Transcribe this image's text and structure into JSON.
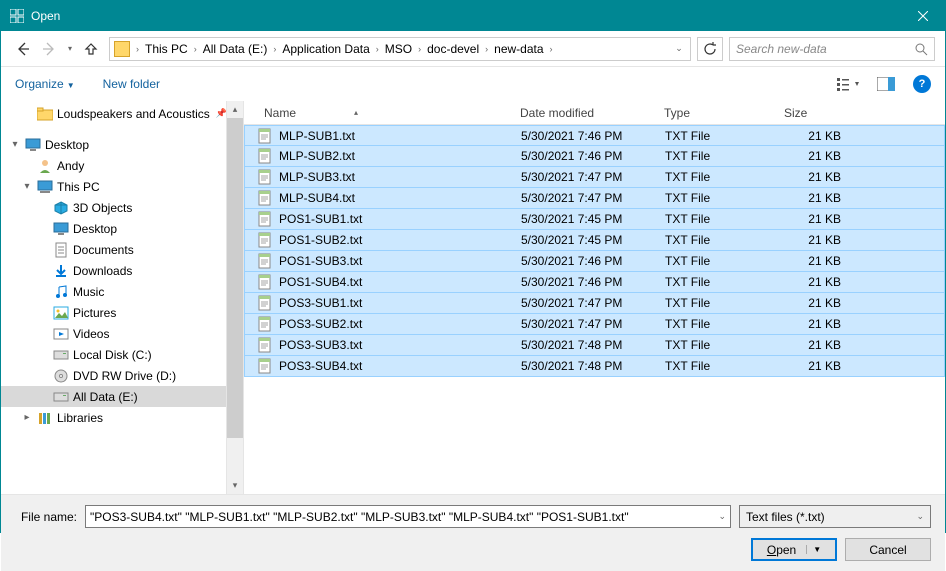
{
  "title": "Open",
  "breadcrumb": [
    "This PC",
    "All Data (E:)",
    "Application Data",
    "MSO",
    "doc-devel",
    "new-data"
  ],
  "search_placeholder": "Search new-data",
  "toolbar": {
    "organize": "Organize",
    "newfolder": "New folder"
  },
  "tree": [
    {
      "label": "Loudspeakers and Acoustics",
      "indent": 1,
      "icon": "folder",
      "pin": true
    },
    {
      "label": "",
      "spacer": true
    },
    {
      "label": "Desktop",
      "indent": 0,
      "icon": "desktop",
      "exp": "▾"
    },
    {
      "label": "Andy",
      "indent": 1,
      "icon": "user"
    },
    {
      "label": "This PC",
      "indent": 1,
      "icon": "pc",
      "exp": "▾"
    },
    {
      "label": "3D Objects",
      "indent": 2,
      "icon": "3d"
    },
    {
      "label": "Desktop",
      "indent": 2,
      "icon": "desktop2"
    },
    {
      "label": "Documents",
      "indent": 2,
      "icon": "doc"
    },
    {
      "label": "Downloads",
      "indent": 2,
      "icon": "down"
    },
    {
      "label": "Music",
      "indent": 2,
      "icon": "music"
    },
    {
      "label": "Pictures",
      "indent": 2,
      "icon": "pic"
    },
    {
      "label": "Videos",
      "indent": 2,
      "icon": "vid"
    },
    {
      "label": "Local Disk (C:)",
      "indent": 2,
      "icon": "disk"
    },
    {
      "label": "DVD RW Drive (D:)",
      "indent": 2,
      "icon": "dvd"
    },
    {
      "label": "All Data (E:)",
      "indent": 2,
      "icon": "disk",
      "sel": true
    },
    {
      "label": "Libraries",
      "indent": 1,
      "icon": "lib",
      "exp": "▸"
    }
  ],
  "columns": {
    "name": "Name",
    "date": "Date modified",
    "type": "Type",
    "size": "Size"
  },
  "files": [
    {
      "name": "MLP-SUB1.txt",
      "date": "5/30/2021 7:46 PM",
      "type": "TXT File",
      "size": "21 KB"
    },
    {
      "name": "MLP-SUB2.txt",
      "date": "5/30/2021 7:46 PM",
      "type": "TXT File",
      "size": "21 KB"
    },
    {
      "name": "MLP-SUB3.txt",
      "date": "5/30/2021 7:47 PM",
      "type": "TXT File",
      "size": "21 KB"
    },
    {
      "name": "MLP-SUB4.txt",
      "date": "5/30/2021 7:47 PM",
      "type": "TXT File",
      "size": "21 KB"
    },
    {
      "name": "POS1-SUB1.txt",
      "date": "5/30/2021 7:45 PM",
      "type": "TXT File",
      "size": "21 KB"
    },
    {
      "name": "POS1-SUB2.txt",
      "date": "5/30/2021 7:45 PM",
      "type": "TXT File",
      "size": "21 KB"
    },
    {
      "name": "POS1-SUB3.txt",
      "date": "5/30/2021 7:46 PM",
      "type": "TXT File",
      "size": "21 KB"
    },
    {
      "name": "POS1-SUB4.txt",
      "date": "5/30/2021 7:46 PM",
      "type": "TXT File",
      "size": "21 KB"
    },
    {
      "name": "POS3-SUB1.txt",
      "date": "5/30/2021 7:47 PM",
      "type": "TXT File",
      "size": "21 KB"
    },
    {
      "name": "POS3-SUB2.txt",
      "date": "5/30/2021 7:47 PM",
      "type": "TXT File",
      "size": "21 KB"
    },
    {
      "name": "POS3-SUB3.txt",
      "date": "5/30/2021 7:48 PM",
      "type": "TXT File",
      "size": "21 KB"
    },
    {
      "name": "POS3-SUB4.txt",
      "date": "5/30/2021 7:48 PM",
      "type": "TXT File",
      "size": "21 KB"
    }
  ],
  "filename_label": "File name:",
  "filename_value": "\"POS3-SUB4.txt\" \"MLP-SUB1.txt\" \"MLP-SUB2.txt\" \"MLP-SUB3.txt\" \"MLP-SUB4.txt\" \"POS1-SUB1.txt\"",
  "filetype": "Text files (*.txt)",
  "open_btn": "pen",
  "open_btn_u": "O",
  "cancel_btn": "Cancel"
}
